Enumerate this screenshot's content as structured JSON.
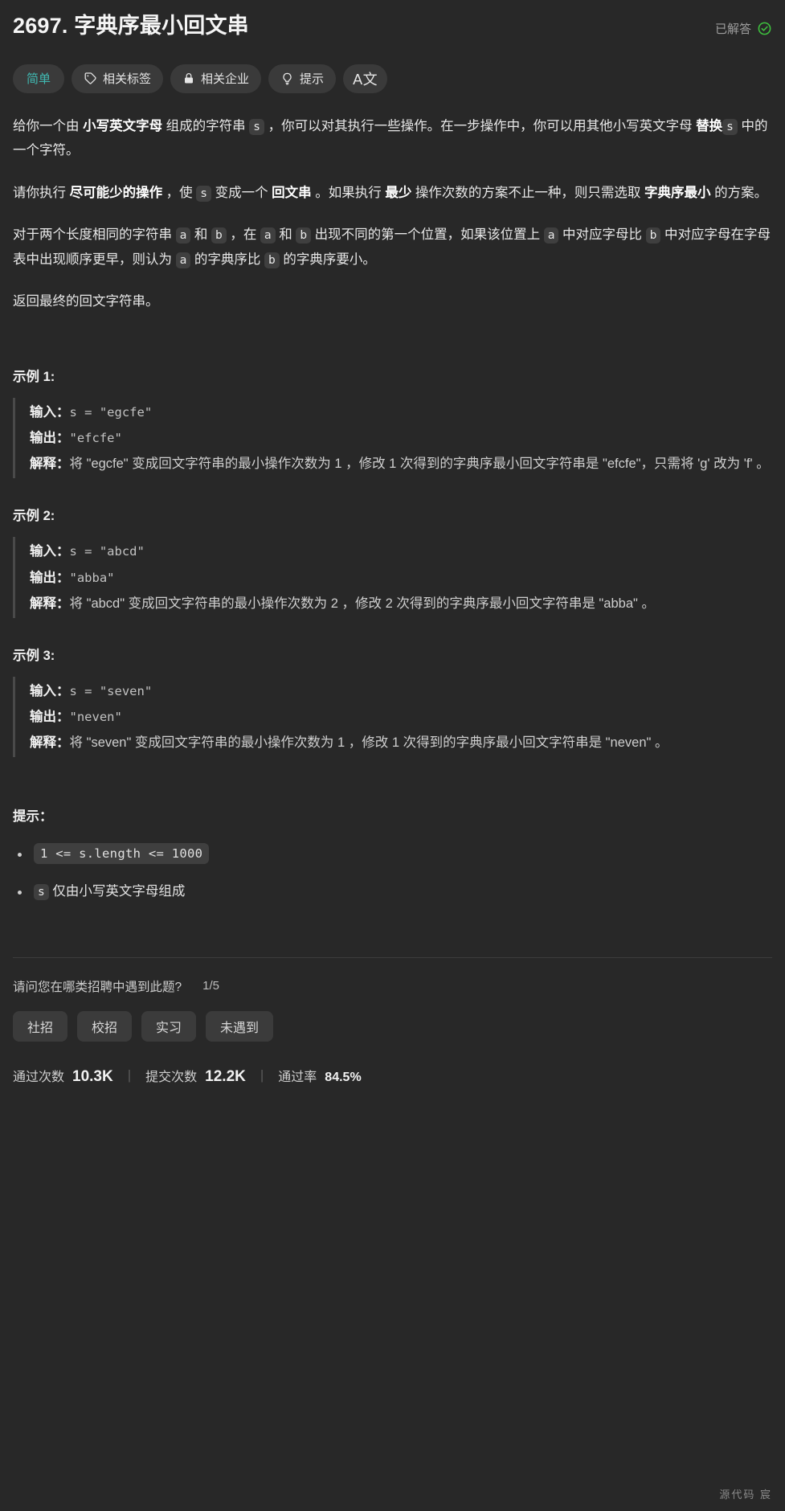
{
  "header": {
    "title": "2697. 字典序最小回文串",
    "solved_label": "已解答",
    "solved_icon": "check-circle-icon",
    "accent_solved": "#3ec13e"
  },
  "tagbar": {
    "difficulty": "简单",
    "difficulty_color": "#40b9b2",
    "related_tags": "相关标签",
    "related_tags_icon": "tag-icon",
    "related_companies": "相关企业",
    "related_companies_icon": "lock-icon",
    "hints": "提示",
    "hints_icon": "lightbulb-icon",
    "translate_icon": "translate-icon",
    "translate_label": "A文"
  },
  "description": {
    "p1_a": "给你一个由 ",
    "p1_b": "小写英文字母",
    "p1_c": " 组成的字符串 ",
    "p1_code1": "s",
    "p1_d": " ，你可以对其执行一些操作。在一步操作中，你可以用其他小写英文字母 ",
    "p1_e": "替换",
    "p1_code2": "s",
    "p1_f": " 中的一个字符。",
    "p2_a": "请你执行 ",
    "p2_b": "尽可能少的操作",
    "p2_c": " ，使 ",
    "p2_code1": "s",
    "p2_d": " 变成一个 ",
    "p2_e": "回文串",
    "p2_f": " 。如果执行 ",
    "p2_g": "最少",
    "p2_h": " 操作次数的方案不止一种，则只需选取 ",
    "p2_i": "字典序最小",
    "p2_j": " 的方案。",
    "p3_a": "对于两个长度相同的字符串 ",
    "p3_code_a1": "a",
    "p3_b": " 和 ",
    "p3_code_b1": "b",
    "p3_c": " ，在 ",
    "p3_code_a2": "a",
    "p3_d": " 和 ",
    "p3_code_b2": "b",
    "p3_e": " 出现不同的第一个位置，如果该位置上 ",
    "p3_code_a3": "a",
    "p3_f": " 中对应字母比 ",
    "p3_code_b3": "b",
    "p3_g": " 中对应字母在字母表中出现顺序更早，则认为 ",
    "p3_code_a4": "a",
    "p3_h": " 的字典序比 ",
    "p3_code_b4": "b",
    "p3_i": " 的字典序要小。",
    "p4": "返回最终的回文字符串。"
  },
  "examples": [
    {
      "title": "示例 1:",
      "input_label": "输入：",
      "input_value": "s = \"egcfe\"",
      "output_label": "输出：",
      "output_value": "\"efcfe\"",
      "explain_label": "解释：",
      "explain_value": "将 \"egcfe\" 变成回文字符串的最小操作次数为 1 ，修改 1 次得到的字典序最小回文字符串是 \"efcfe\"，只需将 'g' 改为 'f' 。"
    },
    {
      "title": "示例 2:",
      "input_label": "输入：",
      "input_value": "s = \"abcd\"",
      "output_label": "输出：",
      "output_value": "\"abba\"",
      "explain_label": "解释：",
      "explain_value": "将 \"abcd\" 变成回文字符串的最小操作次数为 2 ，修改 2 次得到的字典序最小回文字符串是 \"abba\" 。"
    },
    {
      "title": "示例 3:",
      "input_label": "输入：",
      "input_value": "s = \"seven\"",
      "output_label": "输出：",
      "output_value": "\"neven\"",
      "explain_label": "解释：",
      "explain_value": "将 \"seven\" 变成回文字符串的最小操作次数为 1 ，修改 1 次得到的字典序最小回文字符串是 \"neven\" 。"
    }
  ],
  "constraints": {
    "title": "提示：",
    "item1_code": "1 <= s.length <= 1000",
    "item2_code": "s",
    "item2_text": " 仅由小写英文字母组成"
  },
  "survey": {
    "question": "请问您在哪类招聘中遇到此题?",
    "counter": "1/5",
    "options": [
      "社招",
      "校招",
      "实习",
      "未遇到"
    ]
  },
  "stats": {
    "accepted_label": "通过次数",
    "accepted_value": "10.3K",
    "submissions_label": "提交次数",
    "submissions_value": "12.2K",
    "rate_label": "通过率",
    "rate_value": "84.5%",
    "separator": "|"
  },
  "watermark": "源代码 宸"
}
